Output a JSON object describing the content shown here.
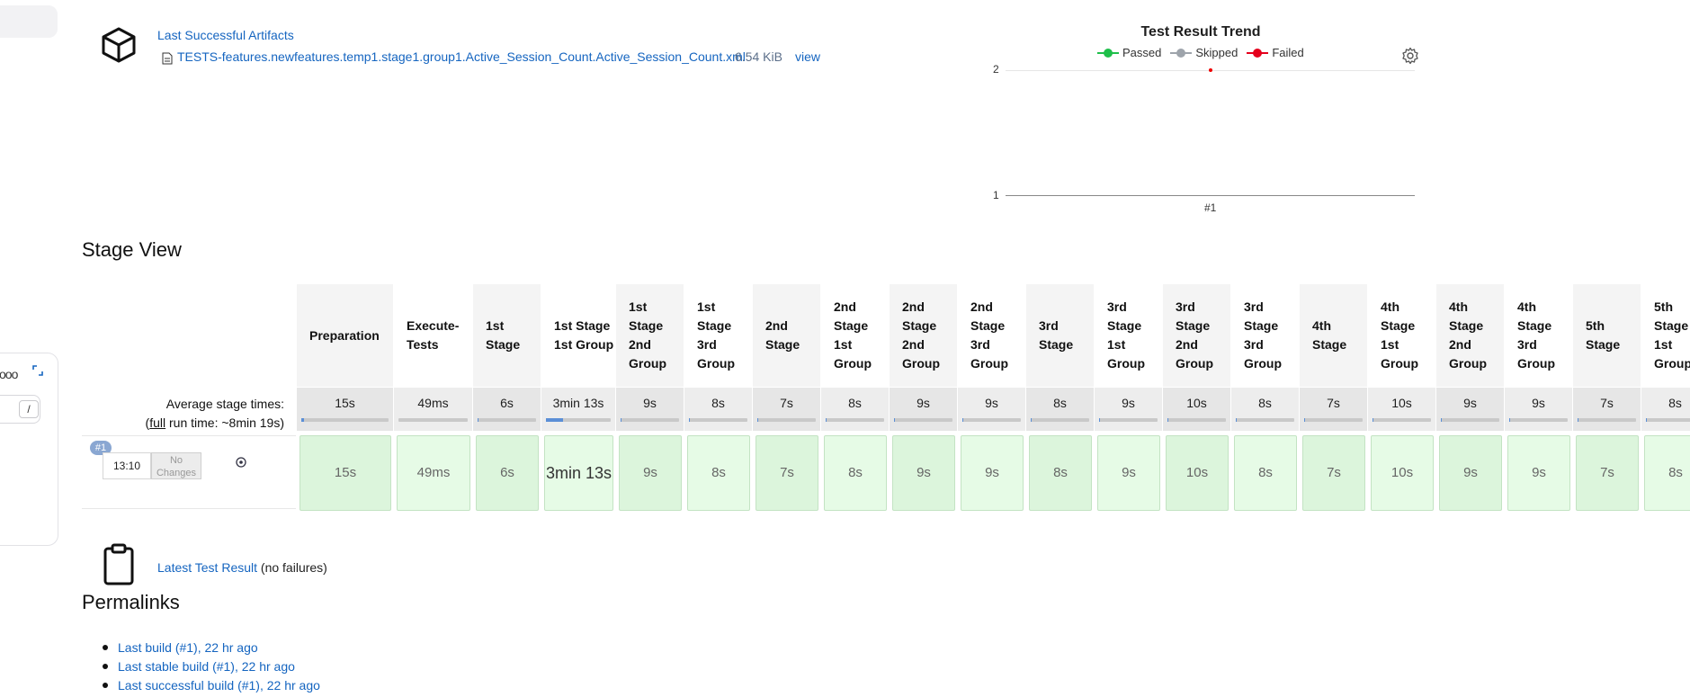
{
  "left_panel": {
    "kbd_hint": "/"
  },
  "artifacts": {
    "title": "Last Successful Artifacts",
    "file_name": "TESTS-features.newfeatures.temp1.stage1.group1.Active_Session_Count.Active_Session_Count.xml",
    "file_size": "6.54 KiB",
    "view_label": "view"
  },
  "trend": {
    "title": "Test Result Trend",
    "legend": [
      {
        "label": "Passed",
        "color": "#1fbf4a"
      },
      {
        "label": "Skipped",
        "color": "#9ea4ab"
      },
      {
        "label": "Failed",
        "color": "#e5001c"
      }
    ],
    "y_ticks": [
      "2",
      "1"
    ],
    "x_ticks": [
      "#1"
    ]
  },
  "chart_data": {
    "type": "line",
    "title": "Test Result Trend",
    "x": [
      "#1"
    ],
    "series": [
      {
        "name": "Passed",
        "values": [
          0
        ]
      },
      {
        "name": "Skipped",
        "values": [
          0
        ]
      },
      {
        "name": "Failed",
        "values": [
          2
        ]
      }
    ],
    "ylim": [
      1,
      2
    ],
    "legend": "top"
  },
  "stage_view": {
    "title": "Stage View",
    "avg_label_line1": "Average stage times:",
    "avg_label_full": "full",
    "avg_label_run": " run time: ~8min 19s)",
    "avg_label_paren": "(",
    "stages": [
      {
        "name": "Preparation",
        "avg": "15s",
        "run": "15s",
        "progress": 0.03
      },
      {
        "name": "Execute-Tests",
        "avg": "49ms",
        "run": "49ms",
        "progress": 0.0
      },
      {
        "name": "1st Stage",
        "avg": "6s",
        "run": "6s",
        "progress": 0.02
      },
      {
        "name": "1st Stage 1st Group",
        "avg": "3min 13s",
        "run": "3min 13s",
        "progress": 0.27
      },
      {
        "name": "1st Stage 2nd Group",
        "avg": "9s",
        "run": "9s",
        "progress": 0.02
      },
      {
        "name": "1st Stage 3rd Group",
        "avg": "8s",
        "run": "8s",
        "progress": 0.02
      },
      {
        "name": "2nd Stage",
        "avg": "7s",
        "run": "7s",
        "progress": 0.02
      },
      {
        "name": "2nd Stage 1st Group",
        "avg": "8s",
        "run": "8s",
        "progress": 0.02
      },
      {
        "name": "2nd Stage 2nd Group",
        "avg": "9s",
        "run": "9s",
        "progress": 0.02
      },
      {
        "name": "2nd Stage 3rd Group",
        "avg": "9s",
        "run": "9s",
        "progress": 0.02
      },
      {
        "name": "3rd Stage",
        "avg": "8s",
        "run": "8s",
        "progress": 0.02
      },
      {
        "name": "3rd Stage 1st Group",
        "avg": "9s",
        "run": "9s",
        "progress": 0.02
      },
      {
        "name": "3rd Stage 2nd Group",
        "avg": "10s",
        "run": "10s",
        "progress": 0.02
      },
      {
        "name": "3rd Stage 3rd Group",
        "avg": "8s",
        "run": "8s",
        "progress": 0.02
      },
      {
        "name": "4th Stage",
        "avg": "7s",
        "run": "7s",
        "progress": 0.02
      },
      {
        "name": "4th Stage 1st Group",
        "avg": "10s",
        "run": "10s",
        "progress": 0.02
      },
      {
        "name": "4th Stage 2nd Group",
        "avg": "9s",
        "run": "9s",
        "progress": 0.02
      },
      {
        "name": "4th Stage 3rd Group",
        "avg": "9s",
        "run": "9s",
        "progress": 0.02
      },
      {
        "name": "5th Stage",
        "avg": "7s",
        "run": "7s",
        "progress": 0.02
      },
      {
        "name": "5th Stage 1st Group",
        "avg": "8s",
        "run": "8s",
        "progress": 0.02
      }
    ],
    "run": {
      "badge": "#1",
      "time": "13:10",
      "no_changes": "No Changes"
    }
  },
  "test_result": {
    "link": "Latest Test Result",
    "note": " (no failures)"
  },
  "permalinks": {
    "title": "Permalinks",
    "items": [
      "Last build (#1), 22 hr ago",
      "Last stable build (#1), 22 hr ago",
      "Last successful build (#1), 22 hr ago"
    ]
  }
}
